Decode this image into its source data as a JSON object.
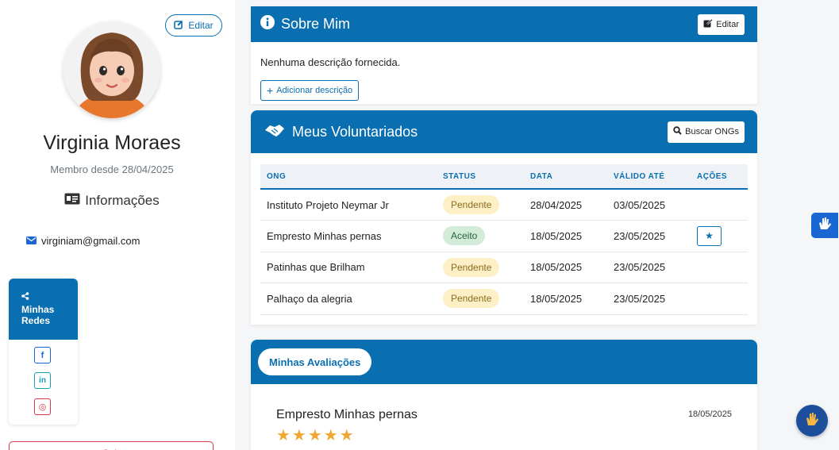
{
  "profile": {
    "edit_label": "Editar",
    "name": "Virginia Moraes",
    "member_since": "Membro desde 28/04/2025",
    "info_title": "Informações",
    "email": "virginiam@gmail.com",
    "networks_title_1": "Minhas",
    "networks_title_2": "Redes",
    "facebook": "f",
    "linkedin": "in",
    "instagram": "◎",
    "exit_label": "Sair"
  },
  "about": {
    "title": "Sobre Mim",
    "edit_label": "Editar",
    "empty_text": "Nenhuma descrição fornecida.",
    "add_label": "Adicionar descrição"
  },
  "volunteering": {
    "title": "Meus Voluntariados",
    "search_label": "Buscar ONGs",
    "columns": [
      "ONG",
      "STATUS",
      "DATA",
      "VÁLIDO ATÉ",
      "AÇÕES"
    ],
    "rows": [
      {
        "ong": "Instituto Projeto Neymar Jr",
        "status": "Pendente",
        "date": "28/04/2025",
        "valid_until": "03/05/2025"
      },
      {
        "ong": "Empresto Minhas pernas",
        "status": "Aceito",
        "date": "18/05/2025",
        "valid_until": "23/05/2025"
      },
      {
        "ong": "Patinhas que Brilham",
        "status": "Pendente",
        "date": "18/05/2025",
        "valid_until": "23/05/2025"
      },
      {
        "ong": "Palhaço da alegria",
        "status": "Pendente",
        "date": "18/05/2025",
        "valid_until": "23/05/2025"
      }
    ]
  },
  "reviews": {
    "tab_label": "Minhas Avaliações",
    "item_title": "Empresto Minhas pernas",
    "item_date": "18/05/2025",
    "item_stars": "★★★★★"
  },
  "colors": {
    "primary": "#0a6fb0",
    "pending_bg": "#fdf0c7",
    "accepted_bg": "#d3ecda",
    "star": "#f0a732"
  }
}
